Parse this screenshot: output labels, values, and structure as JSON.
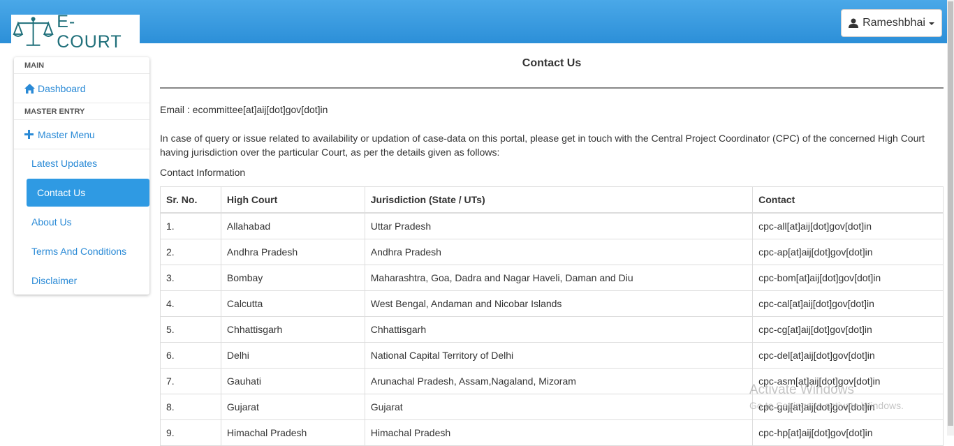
{
  "header": {
    "logo_text": "E-COURT",
    "user_name": "Rameshbhai"
  },
  "sidebar": {
    "section_main": "MAIN",
    "dashboard": "Dashboard",
    "section_master": "MASTER ENTRY",
    "master_menu": "Master Menu",
    "sub_items": [
      "Latest Updates",
      "Contact Us",
      "About Us",
      "Terms And Conditions",
      "Disclaimer"
    ],
    "active_item": "Contact Us"
  },
  "page": {
    "title": "Contact Us",
    "email": "Email : ecommittee[at]aij[dot]gov[dot]in",
    "intro": "In case of query or issue related to availability or updation of case-data on this portal, please get in touch with the Central Project Coordinator (CPC) of the concerned High Court having jurisdiction over the particular Court, as per the details given as follows:",
    "contact_info_label": "Contact Information"
  },
  "table": {
    "headers": [
      "Sr. No.",
      "High Court",
      "Jurisdiction (State / UTs)",
      "Contact"
    ],
    "rows": [
      [
        "1.",
        "Allahabad",
        "Uttar Pradesh",
        "cpc-all[at]aij[dot]gov[dot]in"
      ],
      [
        "2.",
        "Andhra Pradesh",
        "Andhra Pradesh",
        "cpc-ap[at]aij[dot]gov[dot]in"
      ],
      [
        "3.",
        "Bombay",
        "Maharashtra, Goa, Dadra and Nagar Haveli, Daman and Diu",
        "cpc-bom[at]aij[dot]gov[dot]in"
      ],
      [
        "4.",
        "Calcutta",
        "West Bengal, Andaman and Nicobar Islands",
        "cpc-cal[at]aij[dot]gov[dot]in"
      ],
      [
        "5.",
        "Chhattisgarh",
        "Chhattisgarh",
        "cpc-cg[at]aij[dot]gov[dot]in"
      ],
      [
        "6.",
        "Delhi",
        "National Capital Territory of Delhi",
        "cpc-del[at]aij[dot]gov[dot]in"
      ],
      [
        "7.",
        "Gauhati",
        "Arunachal Pradesh, Assam,Nagaland, Mizoram",
        "cpc-asm[at]aij[dot]gov[dot]in"
      ],
      [
        "8.",
        "Gujarat",
        "Gujarat",
        "cpc-guj[at]aij[dot]gov[dot]in"
      ],
      [
        "9.",
        "Himachal Pradesh",
        "Himachal Pradesh",
        "cpc-hp[at]aij[dot]gov[dot]in"
      ]
    ]
  },
  "watermark": {
    "line1": "Activate Windows",
    "line2": "Go to Settings to activate Windows."
  },
  "colors": {
    "header_blue": "#2c8fd8",
    "link_blue": "#2a8ad6",
    "active_blue": "#2f9ae3"
  }
}
